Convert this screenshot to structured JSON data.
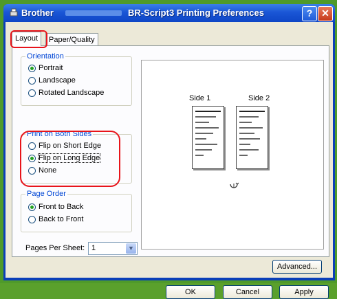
{
  "window": {
    "title_left": "Brother",
    "title_right": "BR-Script3 Printing Preferences",
    "help_label": "?",
    "close_label": "✕"
  },
  "tabs": [
    {
      "label": "Layout",
      "active": true
    },
    {
      "label": "Paper/Quality",
      "active": false
    }
  ],
  "orientation": {
    "title": "Orientation",
    "options": [
      {
        "label": "Portrait",
        "selected": true
      },
      {
        "label": "Landscape",
        "selected": false
      },
      {
        "label": "Rotated Landscape",
        "selected": false
      }
    ]
  },
  "both_sides": {
    "title": "Print on Both Sides",
    "options": [
      {
        "label": "Flip on Short Edge",
        "selected": false
      },
      {
        "label": "Flip on Long Edge",
        "selected": true
      },
      {
        "label": "None",
        "selected": false
      }
    ]
  },
  "page_order": {
    "title": "Page Order",
    "options": [
      {
        "label": "Front to Back",
        "selected": true
      },
      {
        "label": "Back to Front",
        "selected": false
      }
    ]
  },
  "pages_per_sheet": {
    "label": "Pages Per Sheet:",
    "value": "1"
  },
  "preview": {
    "side1_label": "Side 1",
    "side2_label": "Side 2",
    "flip_icon": "flip-arrow-icon"
  },
  "buttons": {
    "advanced": "Advanced...",
    "ok": "OK",
    "cancel": "Cancel",
    "apply": "Apply"
  },
  "colors": {
    "highlight": "#e8141a",
    "title_bar": "#1a56d6",
    "group_title": "#0046d5"
  }
}
